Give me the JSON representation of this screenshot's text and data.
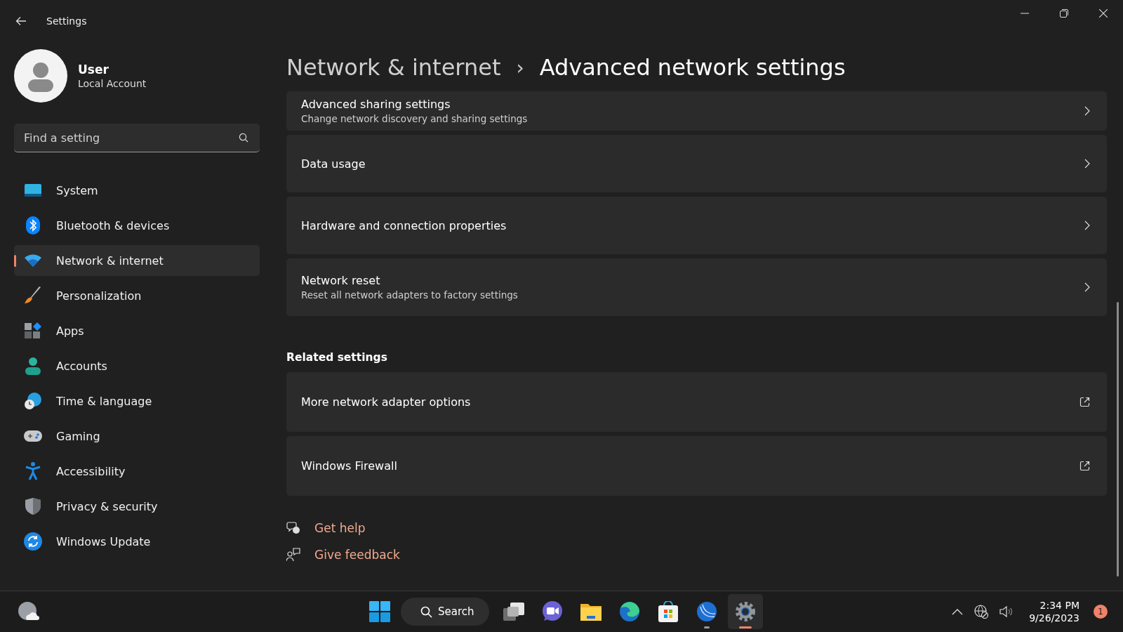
{
  "window": {
    "title": "Settings"
  },
  "user": {
    "name": "User",
    "account": "Local Account"
  },
  "search": {
    "placeholder": "Find a setting"
  },
  "sidebar": {
    "items": [
      {
        "label": "System",
        "selected": false
      },
      {
        "label": "Bluetooth & devices",
        "selected": false
      },
      {
        "label": "Network & internet",
        "selected": true
      },
      {
        "label": "Personalization",
        "selected": false
      },
      {
        "label": "Apps",
        "selected": false
      },
      {
        "label": "Accounts",
        "selected": false
      },
      {
        "label": "Time & language",
        "selected": false
      },
      {
        "label": "Gaming",
        "selected": false
      },
      {
        "label": "Accessibility",
        "selected": false
      },
      {
        "label": "Privacy & security",
        "selected": false
      },
      {
        "label": "Windows Update",
        "selected": false
      }
    ]
  },
  "breadcrumb": {
    "parent": "Network & internet",
    "separator": "›",
    "current": "Advanced network settings"
  },
  "cards": [
    {
      "kind": "nav",
      "title": "Advanced sharing settings",
      "subtitle": "Change network discovery and sharing settings"
    },
    {
      "kind": "nav",
      "title": "Data usage"
    },
    {
      "kind": "nav",
      "title": "Hardware and connection properties"
    },
    {
      "kind": "nav",
      "title": "Network reset",
      "subtitle": "Reset all network adapters to factory settings"
    }
  ],
  "related": {
    "heading": "Related settings",
    "cards": [
      {
        "kind": "external",
        "title": "More network adapter options"
      },
      {
        "kind": "external",
        "title": "Windows Firewall"
      }
    ]
  },
  "links": [
    "Get help",
    "Give feedback"
  ],
  "taskbar": {
    "search": "Search",
    "apps": [
      {
        "selected": false,
        "running": false
      },
      {
        "selected": false,
        "running": false
      },
      {
        "selected": false,
        "running": false
      },
      {
        "selected": false,
        "running": false
      },
      {
        "selected": false,
        "running": false
      },
      {
        "selected": false,
        "running": true
      },
      {
        "selected": true,
        "running": true
      }
    ],
    "time": "2:34 PM",
    "date": "9/26/2023",
    "notifications": "1"
  }
}
